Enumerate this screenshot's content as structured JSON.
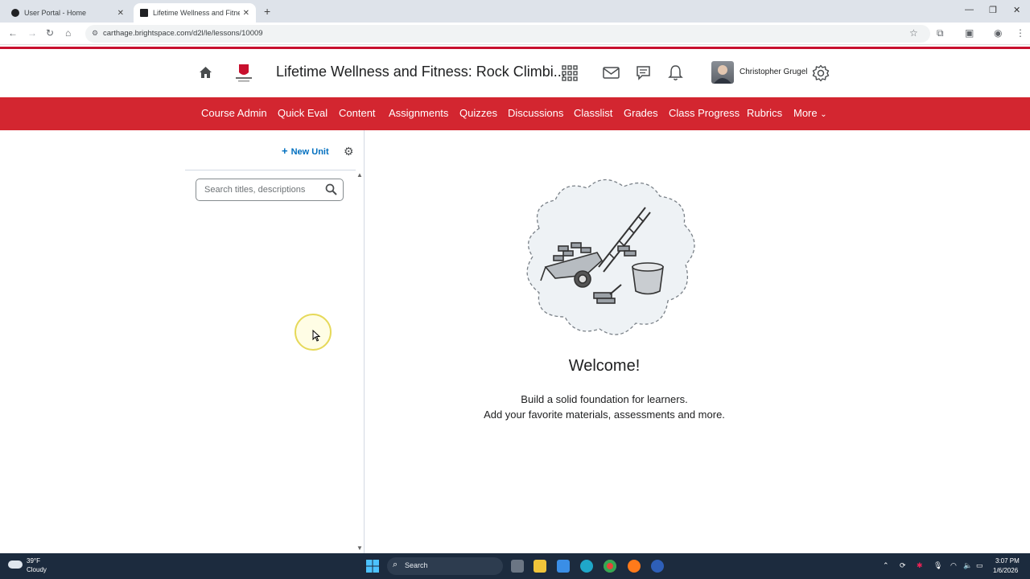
{
  "browser": {
    "tabs": [
      {
        "label": "User Portal - Home",
        "active": false
      },
      {
        "label": "Lifetime Wellness and Fitness: R",
        "active": true
      }
    ],
    "url": "carthage.brightspace.com/d2l/le/lessons/10009"
  },
  "header": {
    "course_title": "Lifetime Wellness and Fitness: Rock Climbi...",
    "user_name": "Christopher Grugel"
  },
  "nav": {
    "items": [
      "Course Admin",
      "Quick Eval",
      "Content",
      "Assignments",
      "Quizzes",
      "Discussions",
      "Classlist",
      "Grades",
      "Class Progress",
      "Rubrics",
      "More"
    ]
  },
  "sidebar": {
    "new_unit_label": "New Unit",
    "search_placeholder": "Search titles, descriptions"
  },
  "main": {
    "welcome_title": "Welcome!",
    "welcome_line1": "Build a solid foundation for learners.",
    "welcome_line2": "Add your favorite materials, assessments and more."
  },
  "taskbar": {
    "temperature": "39°F",
    "condition": "Cloudy",
    "search_label": "Search",
    "time": "3:07 PM",
    "date": "1/6/2026"
  },
  "colors": {
    "brand_red": "#d32630",
    "link_blue": "#006fbf"
  }
}
